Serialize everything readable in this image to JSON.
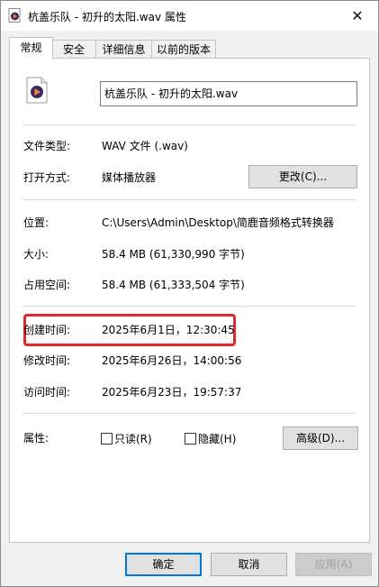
{
  "window": {
    "title": "杭盖乐队 - 初升的太阳.wav 属性",
    "close_glyph": "✕"
  },
  "tabs": [
    {
      "label": "常规"
    },
    {
      "label": "安全"
    },
    {
      "label": "详细信息"
    },
    {
      "label": "以前的版本"
    }
  ],
  "general": {
    "file_name": "杭盖乐队 - 初升的太阳.wav",
    "file_type_label": "文件类型:",
    "file_type_value": "WAV 文件 (.wav)",
    "open_with_label": "打开方式:",
    "open_with_value": "媒体播放器",
    "change_button": "更改(C)...",
    "location_label": "位置:",
    "location_value": "C:\\Users\\Admin\\Desktop\\简鹿音频格式转换器",
    "size_label": "大小:",
    "size_value": "58.4 MB (61,330,990 字节)",
    "disk_size_label": "占用空间:",
    "disk_size_value": "58.4 MB (61,333,504 字节)",
    "created_label": "创建时间:",
    "created_value": "2025年6月1日，12:30:45",
    "modified_label": "修改时间:",
    "modified_value": "2025年6月26日，14:00:56",
    "accessed_label": "访问时间:",
    "accessed_value": "2025年6月23日，19:57:37",
    "attributes_label": "属性:",
    "readonly_label": "只读(R)",
    "hidden_label": "隐藏(H)",
    "advanced_button": "高级(D)..."
  },
  "footer": {
    "ok": "确定",
    "cancel": "取消",
    "apply": "应用(A)"
  },
  "colors": {
    "highlight": "#e0262f",
    "primary_border": "#0078d7"
  }
}
